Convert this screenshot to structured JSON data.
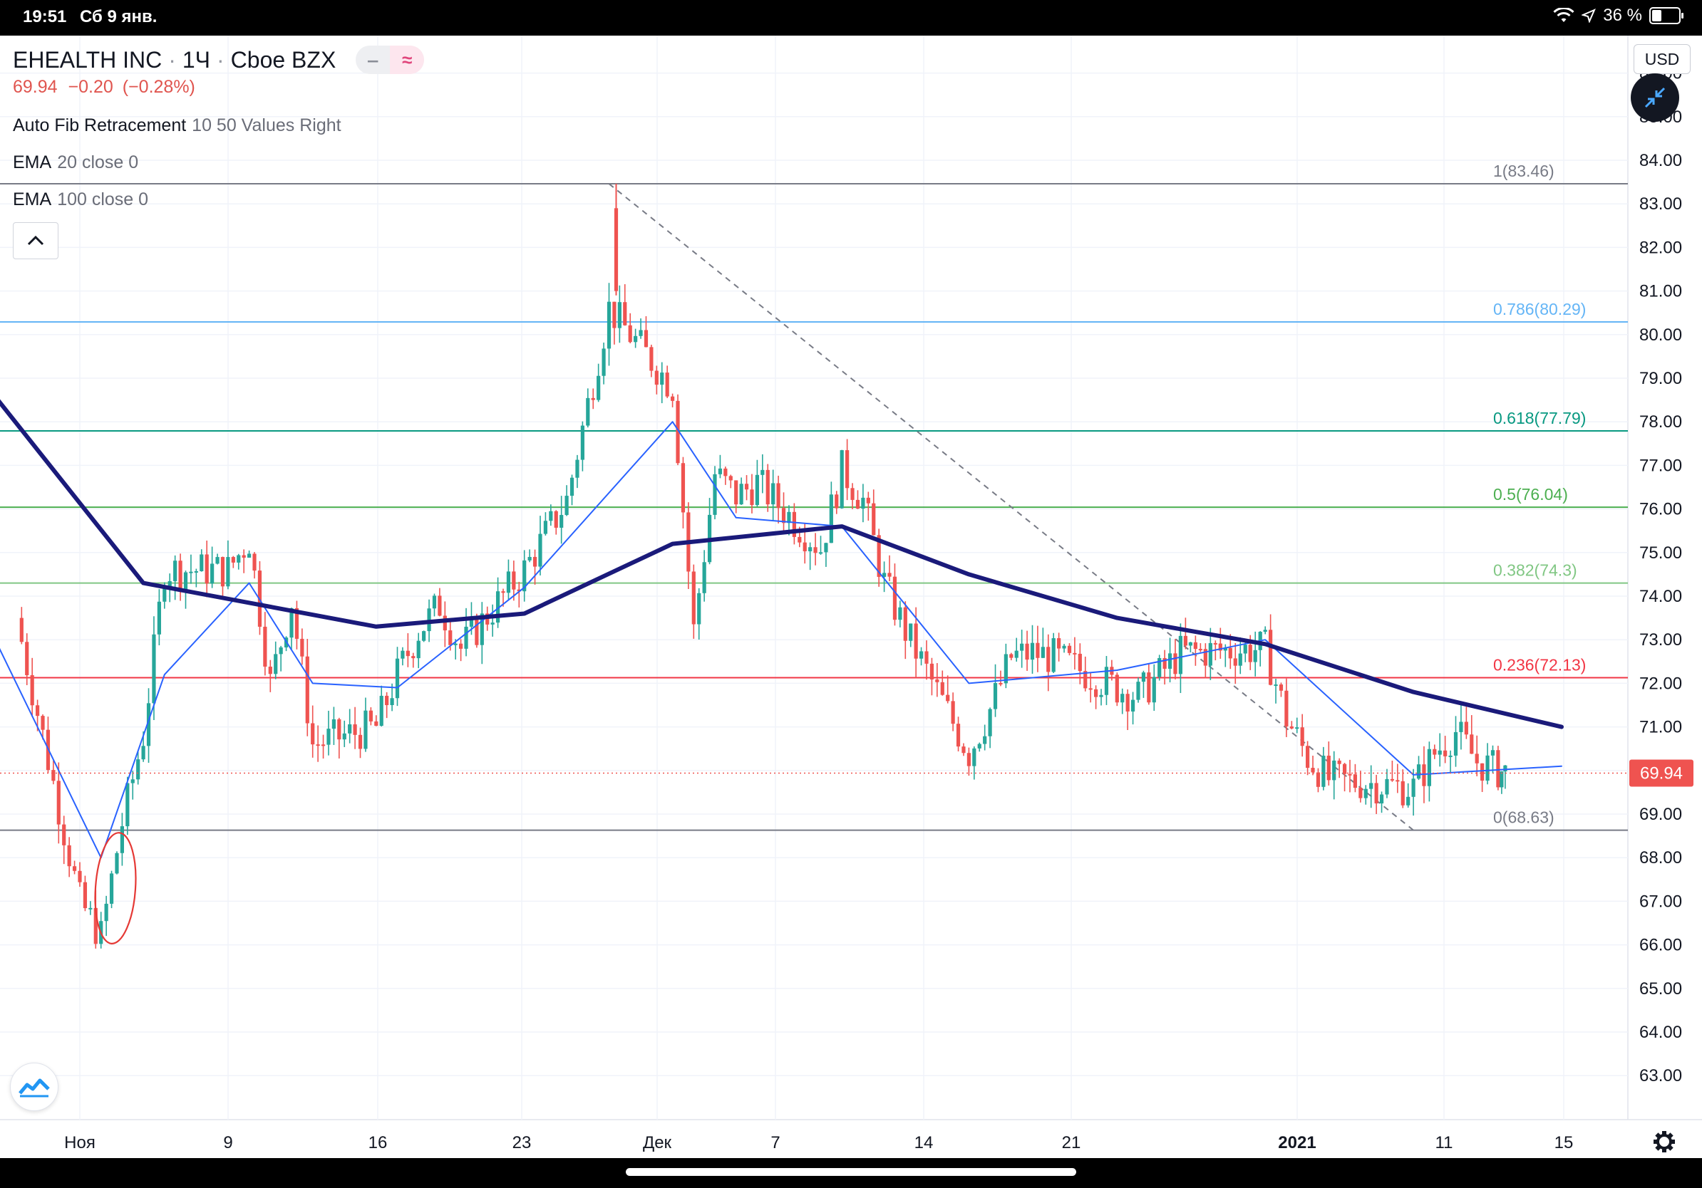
{
  "status_bar": {
    "time": "19:51",
    "date": "Сб 9 янв.",
    "battery": "36 %"
  },
  "symbol": {
    "name": "EHEALTH INC",
    "interval": "1Ч",
    "exchange": "Cboe BZX",
    "pill_minus": "‒",
    "pill_wave": "≈"
  },
  "quote": {
    "last": "69.94",
    "change": "−0.20",
    "change_pct": "(−0.28%)"
  },
  "indicators": [
    {
      "name": "Auto Fib Retracement",
      "params": "10 50 Values Right"
    },
    {
      "name": "EMA",
      "params": "20 close 0"
    },
    {
      "name": "EMA",
      "params": "100 close 0"
    }
  ],
  "collapse_label": "⌃",
  "currency_button": "USD",
  "price_axis": {
    "ticks": [
      "63.00",
      "64.00",
      "65.00",
      "66.00",
      "67.00",
      "68.00",
      "69.00",
      "70.00",
      "71.00",
      "72.00",
      "73.00",
      "74.00",
      "75.00",
      "76.00",
      "77.00",
      "78.00",
      "79.00",
      "80.00",
      "81.00",
      "82.00",
      "83.00",
      "84.00",
      "85.00",
      "86.00"
    ],
    "last_price_label": "69.94"
  },
  "time_axis": {
    "labels": [
      {
        "label": "Ноя",
        "bold": false
      },
      {
        "label": "9",
        "bold": false
      },
      {
        "label": "16",
        "bold": false
      },
      {
        "label": "23",
        "bold": false
      },
      {
        "label": "Дек",
        "bold": false
      },
      {
        "label": "7",
        "bold": false
      },
      {
        "label": "14",
        "bold": false
      },
      {
        "label": "21",
        "bold": false
      },
      {
        "label": "2021",
        "bold": true
      },
      {
        "label": "11",
        "bold": false
      },
      {
        "label": "15",
        "bold": false
      }
    ]
  },
  "fib_levels": [
    {
      "label": "1(83.46)",
      "price": 83.46,
      "color": "#787b86"
    },
    {
      "label": "0.786(80.29)",
      "price": 80.29,
      "color": "#64b5f6"
    },
    {
      "label": "0.618(77.79)",
      "price": 77.79,
      "color": "#089981"
    },
    {
      "label": "0.5(76.04)",
      "price": 76.04,
      "color": "#4caf50"
    },
    {
      "label": "0.382(74.3)",
      "price": 74.3,
      "color": "#81c784"
    },
    {
      "label": "0.236(72.13)",
      "price": 72.13,
      "color": "#f23645"
    },
    {
      "label": "0(68.63)",
      "price": 68.63,
      "color": "#787b86"
    }
  ],
  "colors": {
    "up": "#26a69a",
    "down": "#ef5350",
    "ema20": "#2962ff",
    "ema100": "#1a1a7a",
    "last_price": "#ef5350",
    "annotation": "#e53935"
  },
  "chart_data": {
    "type": "candlestick",
    "title": "EHEALTH INC · 1Ч · Cboe BZX",
    "x_range": [
      "2020-10-27",
      "2021-01-16"
    ],
    "y_range": [
      62.0,
      86.0
    ],
    "last_price": 69.94,
    "ohlc_hourly_approx": [
      {
        "date": "2020-10-30",
        "close": 73.5
      },
      {
        "date": "2020-11-02",
        "close": 67.0
      },
      {
        "date": "2020-11-03",
        "close": 66.2
      },
      {
        "date": "2020-11-04",
        "close": 68.8
      },
      {
        "date": "2020-11-05",
        "close": 70.8
      },
      {
        "date": "2020-11-06",
        "close": 74.6
      },
      {
        "date": "2020-11-09",
        "close": 74.6
      },
      {
        "date": "2020-11-10",
        "close": 75.3
      },
      {
        "date": "2020-11-11",
        "close": 72.0
      },
      {
        "date": "2020-11-12",
        "close": 73.9
      },
      {
        "date": "2020-11-13",
        "close": 70.6
      },
      {
        "date": "2020-11-16",
        "close": 71.0
      },
      {
        "date": "2020-11-17",
        "close": 72.2
      },
      {
        "date": "2020-11-18",
        "close": 73.2
      },
      {
        "date": "2020-11-19",
        "close": 73.8
      },
      {
        "date": "2020-11-20",
        "close": 72.8
      },
      {
        "date": "2020-11-23",
        "close": 74.6
      },
      {
        "date": "2020-11-24",
        "close": 75.4
      },
      {
        "date": "2020-11-25",
        "close": 76.2
      },
      {
        "date": "2020-11-27",
        "close": 80.6
      },
      {
        "date": "2020-11-30",
        "close": 78.8
      },
      {
        "date": "2020-12-01",
        "close": 73.2
      },
      {
        "date": "2020-12-02",
        "close": 76.8
      },
      {
        "date": "2020-12-03",
        "close": 76.3
      },
      {
        "date": "2020-12-04",
        "close": 76.6
      },
      {
        "date": "2020-12-07",
        "close": 75.1
      },
      {
        "date": "2020-12-08",
        "close": 76.9
      },
      {
        "date": "2020-12-09",
        "close": 76.2
      },
      {
        "date": "2020-12-10",
        "close": 74.3
      },
      {
        "date": "2020-12-11",
        "close": 73.2
      },
      {
        "date": "2020-12-14",
        "close": 70.4
      },
      {
        "date": "2020-12-15",
        "close": 71.4
      },
      {
        "date": "2020-12-16",
        "close": 72.6
      },
      {
        "date": "2020-12-17",
        "close": 72.7
      },
      {
        "date": "2020-12-18",
        "close": 72.6
      },
      {
        "date": "2020-12-21",
        "close": 71.9
      },
      {
        "date": "2020-12-22",
        "close": 71.7
      },
      {
        "date": "2020-12-23",
        "close": 72.2
      },
      {
        "date": "2020-12-24",
        "close": 72.7
      },
      {
        "date": "2020-12-28",
        "close": 72.8
      },
      {
        "date": "2020-12-29",
        "close": 71.2
      },
      {
        "date": "2020-12-30",
        "close": 70.3
      },
      {
        "date": "2020-12-31",
        "close": 69.8
      },
      {
        "date": "2021-01-04",
        "close": 69.6
      },
      {
        "date": "2021-01-05",
        "close": 70.4
      },
      {
        "date": "2021-01-06",
        "close": 70.9
      },
      {
        "date": "2021-01-07",
        "close": 70.2
      },
      {
        "date": "2021-01-08",
        "close": 70.0
      },
      {
        "date": "2021-01-08",
        "close": 69.94
      }
    ],
    "ema100_approx": [
      {
        "date": "2020-10-27",
        "value": 79.8
      },
      {
        "date": "2020-11-05",
        "value": 74.3
      },
      {
        "date": "2020-11-16",
        "value": 73.3
      },
      {
        "date": "2020-11-23",
        "value": 73.6
      },
      {
        "date": "2020-11-30",
        "value": 75.2
      },
      {
        "date": "2020-12-08",
        "value": 75.6
      },
      {
        "date": "2020-12-14",
        "value": 74.5
      },
      {
        "date": "2020-12-21",
        "value": 73.5
      },
      {
        "date": "2020-12-28",
        "value": 72.9
      },
      {
        "date": "2021-01-04",
        "value": 71.8
      },
      {
        "date": "2021-01-11",
        "value": 71.0
      }
    ],
    "ema20_approx": [
      {
        "date": "2020-10-27",
        "value": 75.0
      },
      {
        "date": "2020-11-03",
        "value": 68.0
      },
      {
        "date": "2020-11-06",
        "value": 72.2
      },
      {
        "date": "2020-11-10",
        "value": 74.3
      },
      {
        "date": "2020-11-13",
        "value": 72.0
      },
      {
        "date": "2020-11-17",
        "value": 71.9
      },
      {
        "date": "2020-11-23",
        "value": 74.2
      },
      {
        "date": "2020-11-30",
        "value": 78.0
      },
      {
        "date": "2020-12-03",
        "value": 75.8
      },
      {
        "date": "2020-12-08",
        "value": 75.6
      },
      {
        "date": "2020-12-14",
        "value": 72.0
      },
      {
        "date": "2020-12-21",
        "value": 72.3
      },
      {
        "date": "2020-12-28",
        "value": 73.0
      },
      {
        "date": "2021-01-04",
        "value": 69.9
      },
      {
        "date": "2021-01-11",
        "value": 70.1
      }
    ],
    "trend_line": {
      "from": {
        "date": "2020-11-27",
        "price": 83.46
      },
      "to": {
        "date": "2021-01-04",
        "price": 68.63
      }
    }
  }
}
